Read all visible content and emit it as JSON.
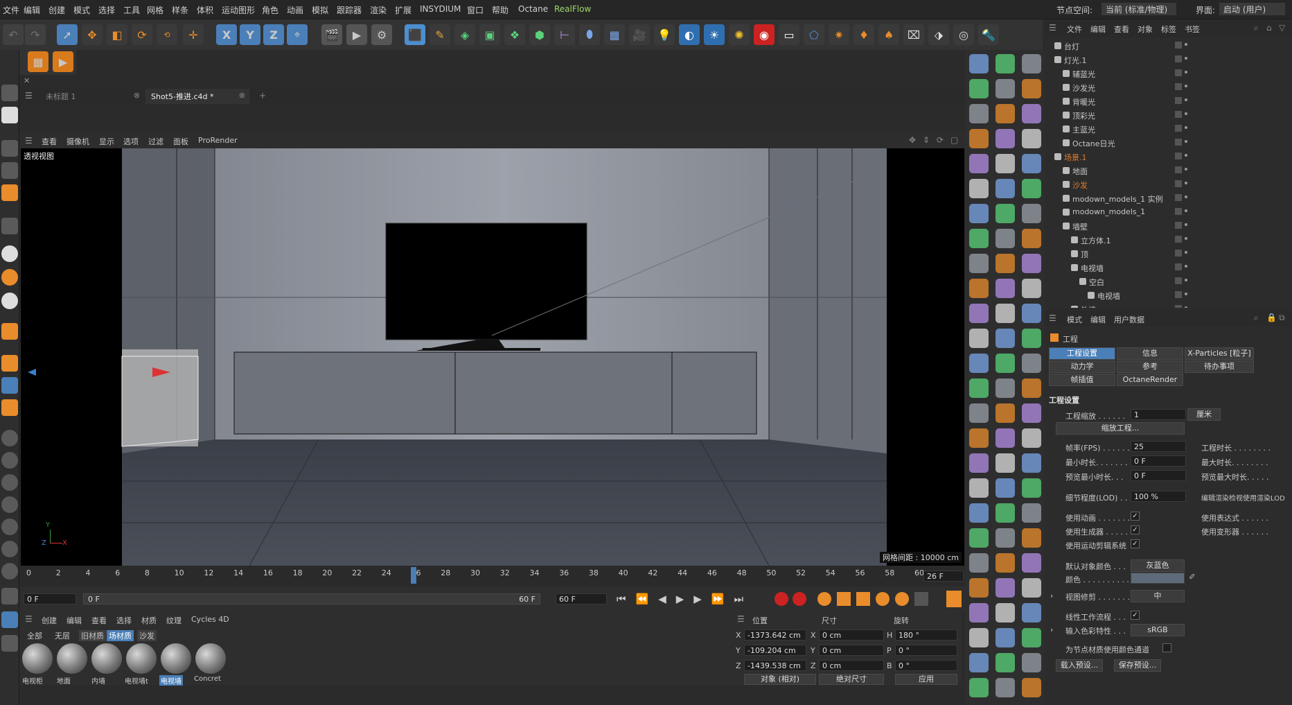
{
  "menubar": {
    "items": [
      "文件",
      "编辑",
      "创建",
      "模式",
      "选择",
      "工具",
      "网格",
      "样条",
      "体积",
      "运动图形",
      "角色",
      "动画",
      "模拟",
      "跟踪器",
      "渲染",
      "扩展",
      "INSYDIUM",
      "窗口",
      "帮助",
      "Octane",
      "RealFlow"
    ],
    "node_space_label": "节点空间:",
    "node_space_value": "当前 (标准/物理)",
    "interface_label": "界面:",
    "interface_value": "启动 (用户)"
  },
  "toolbar": {
    "axis_x": "X",
    "axis_y": "Y",
    "axis_z": "Z"
  },
  "tabs": [
    {
      "label": "未标题 1"
    },
    {
      "label": "Shot5-推进.c4d *"
    }
  ],
  "tab_add": "+",
  "viewport_menu": [
    "查看",
    "摄像机",
    "显示",
    "选项",
    "过滤",
    "面板",
    "ProRender"
  ],
  "viewport": {
    "name": "透视视图",
    "grid_spacing": "网格间距 : 10000 cm",
    "axis_y": "Y",
    "axis_z": "Z",
    "axis_x": "X"
  },
  "timeline": {
    "ticks": [
      "0",
      "2",
      "4",
      "6",
      "8",
      "10",
      "12",
      "14",
      "16",
      "18",
      "20",
      "22",
      "24",
      "26",
      "28",
      "30",
      "32",
      "34",
      "36",
      "38",
      "40",
      "42",
      "44",
      "46",
      "48",
      "50",
      "52",
      "54",
      "56",
      "58",
      "60"
    ],
    "current_frame": "26 F",
    "playhead_fraction": 0.4333
  },
  "transport": {
    "start": "0 F",
    "range_start": "0 F",
    "range_end": "60 F",
    "end": "60 F"
  },
  "materials": {
    "menu": [
      "创建",
      "编辑",
      "查看",
      "选择",
      "材质",
      "纹理",
      "Cycles 4D"
    ],
    "filters": [
      "全部",
      "无层",
      "旧材质",
      "场材质",
      "沙发"
    ],
    "active_filter": "场材质",
    "items": [
      {
        "label": "电视柜"
      },
      {
        "label": "地面"
      },
      {
        "label": "内墙"
      },
      {
        "label": "电视墙t"
      },
      {
        "label": "电视墙"
      },
      {
        "label": "Concret"
      }
    ],
    "selected": "电视墙"
  },
  "coords": {
    "headers": {
      "position": "位置",
      "size": "尺寸",
      "rotation": "旋转"
    },
    "rows": [
      {
        "axis": "X",
        "pos": "-1373.642 cm",
        "size_axis": "X",
        "size": "0 cm",
        "rot_axis": "H",
        "rot": "180 °"
      },
      {
        "axis": "Y",
        "pos": "-109.204 cm",
        "size_axis": "Y",
        "size": "0 cm",
        "rot_axis": "P",
        "rot": "0 °"
      },
      {
        "axis": "Z",
        "pos": "-1439.538 cm",
        "size_axis": "Z",
        "size": "0 cm",
        "rot_axis": "B",
        "rot": "0 °"
      }
    ],
    "mode": "对象 (相对)",
    "size_mode": "绝对尺寸",
    "apply": "应用"
  },
  "objmgr": {
    "menu": [
      "文件",
      "编辑",
      "查看",
      "对象",
      "标签",
      "书签"
    ],
    "rows": [
      {
        "name": "台灯",
        "indent": 0,
        "color": "#c8c8c8"
      },
      {
        "name": "灯光.1",
        "indent": 0,
        "color": "#c8c8c8"
      },
      {
        "name": "辅蓝光",
        "indent": 1,
        "color": "#c8c8c8"
      },
      {
        "name": "沙发光",
        "indent": 1,
        "color": "#c8c8c8"
      },
      {
        "name": "背暖光",
        "indent": 1,
        "color": "#c8c8c8"
      },
      {
        "name": "顶彩光",
        "indent": 1,
        "color": "#c8c8c8"
      },
      {
        "name": "主蓝光",
        "indent": 1,
        "color": "#c8c8c8"
      },
      {
        "name": "Octane日光",
        "indent": 1,
        "color": "#c8c8c8"
      },
      {
        "name": "场景.1",
        "indent": 0,
        "color": "#e07b2a"
      },
      {
        "name": "地面",
        "indent": 1,
        "color": "#c8c8c8"
      },
      {
        "name": "沙发",
        "indent": 1,
        "color": "#e07b2a"
      },
      {
        "name": "modown_models_1 实例",
        "indent": 1,
        "color": "#c8c8c8"
      },
      {
        "name": "modown_models_1",
        "indent": 1,
        "color": "#c8c8c8"
      },
      {
        "name": "墙壁",
        "indent": 1,
        "color": "#c8c8c8"
      },
      {
        "name": "立方体.1",
        "indent": 2,
        "color": "#c8c8c8"
      },
      {
        "name": "顶",
        "indent": 2,
        "color": "#c8c8c8"
      },
      {
        "name": "电视墙",
        "indent": 2,
        "color": "#c8c8c8"
      },
      {
        "name": "空白",
        "indent": 3,
        "color": "#c8c8c8"
      },
      {
        "name": "电视墙",
        "indent": 4,
        "color": "#c8c8c8"
      },
      {
        "name": "外墙",
        "indent": 2,
        "color": "#c8c8c8"
      }
    ]
  },
  "attr": {
    "menu": [
      "模式",
      "编辑",
      "用户数据"
    ],
    "object": "工程",
    "tabs_row1": [
      "工程设置",
      "信息",
      "X-Particles [粒子]"
    ],
    "tabs_row2": [
      "动力学",
      "参考",
      "待办事项"
    ],
    "tabs_row3": [
      "帧插值",
      "OctaneRender"
    ],
    "section": "工程设置",
    "scale_label": "工程缩放 . . . . . .",
    "scale_value": "1",
    "scale_unit": "厘米",
    "scale_btn": "缩放工程...",
    "fps_label": "帧率(FPS) . . . . . .",
    "fps_value": "25",
    "duration_label": "工程时长 . . . . . . . .",
    "min_label": "最小时长. . . . . . .",
    "min_value": "0 F",
    "max_label": "最大时长. . . . . . . .",
    "pmin_label": "预览最小时长. . .",
    "pmin_value": "0 F",
    "pmax_label": "预览最大时长. . . . .",
    "lod_label": "细节程度(LOD) . .",
    "lod_value": "100 %",
    "lod_right": "编辑渲染检视使用渲染LOD",
    "anim_label": "使用动画 . . . . . . .",
    "expr_label": "使用表达式 . . . . . .",
    "gen_label": "使用生成器 . . . . . .",
    "deform_label": "使用变形器 . . . . . .",
    "motion_label": "使用运动剪辑系统",
    "defcolor_label": "默认对象颜色 . . .",
    "defcolor_value": "灰蓝色",
    "color_label": "颜色 . . . . . . . . . . .",
    "viewclip_label": "视图修剪 . . . . . . .",
    "viewclip_value": "中",
    "linear_label": "线性工作流程 . . .",
    "inputcolor_label": "输入色彩特性 . . .",
    "inputcolor_value": "sRGB",
    "nodemat_label": "为节点材质使用颜色通道",
    "load_btn": "载入预设...",
    "save_btn": "保存预设..."
  }
}
